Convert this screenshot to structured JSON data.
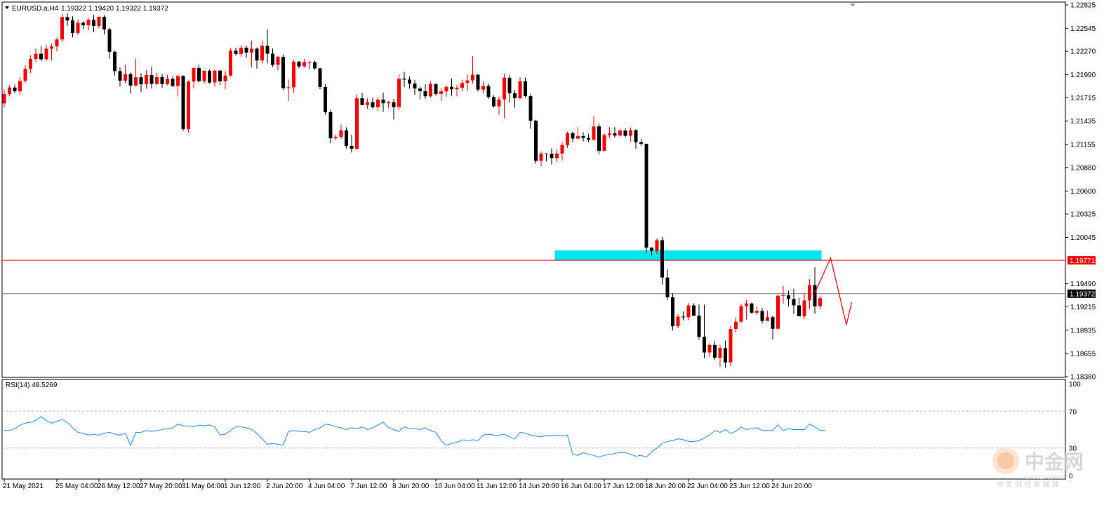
{
  "header": {
    "symbol": "EURUSD.a,H4",
    "ohlc": "1.19322 1.19420 1.19322 1.19372"
  },
  "rsi": {
    "label": "RSI(14) 49.5269",
    "levels": [
      {
        "label": "100",
        "value": 100,
        "line": false
      },
      {
        "label": "70",
        "value": 70,
        "line": true
      },
      {
        "label": "30",
        "value": 30,
        "line": true
      },
      {
        "label": "0",
        "value": 0,
        "line": false
      }
    ],
    "color": "#1e90ff",
    "values": [
      49,
      49,
      51,
      55,
      57,
      58,
      60,
      64,
      60,
      57,
      59,
      61,
      58,
      52,
      47,
      46,
      44,
      45,
      44,
      46,
      47,
      45,
      44,
      46,
      33,
      47,
      47,
      49,
      48,
      49,
      50,
      51,
      52,
      56,
      54,
      54,
      53,
      55,
      54,
      55,
      53,
      44,
      45,
      49,
      53,
      53,
      52,
      50,
      46,
      40,
      34,
      35,
      34,
      33,
      48,
      49,
      48,
      48,
      47,
      50,
      52,
      56,
      55,
      53,
      52,
      50,
      52,
      51,
      53,
      50,
      52,
      55,
      58,
      52,
      50,
      48,
      53,
      51,
      51,
      50,
      52,
      49,
      47,
      38,
      33,
      35,
      36,
      39,
      38,
      39,
      38,
      44,
      45,
      44,
      44,
      45,
      42,
      40,
      47,
      46,
      44,
      43,
      42,
      44,
      43,
      44,
      43,
      44,
      23,
      22,
      25,
      23,
      22,
      20,
      22,
      23,
      24,
      25,
      25,
      23,
      21,
      22,
      20,
      26,
      30,
      35,
      37,
      38,
      40,
      39,
      37,
      37,
      38,
      41,
      44,
      49,
      47,
      50,
      46,
      48,
      53,
      50,
      51,
      52,
      49,
      49,
      49,
      55,
      49,
      51,
      50,
      50,
      50,
      56,
      53,
      49,
      49
    ],
    "ymin": 0,
    "ymax": 100
  },
  "chart_data": {
    "type": "candlestick",
    "symbol": "EURUSD.a",
    "timeframe": "H4",
    "ylim": [
      1.1838,
      1.2285
    ],
    "y_ticks": [
      "1.22825",
      "1.22545",
      "1.22270",
      "1.21990",
      "1.21715",
      "1.21435",
      "1.21155",
      "1.20880",
      "1.20600",
      "1.20325",
      "1.20045",
      "1.19490",
      "1.19215",
      "1.18935",
      "1.18655",
      "1.18380"
    ],
    "x_ticks": [
      {
        "label": "21 May 2021",
        "index": 0
      },
      {
        "label": "25 May 04:00",
        "index": 10
      },
      {
        "label": "26 May 12:00",
        "index": 18
      },
      {
        "label": "27 May 20:00",
        "index": 26
      },
      {
        "label": "31 May 04:00",
        "index": 34
      },
      {
        "label": "1 Jun 12:00",
        "index": 42
      },
      {
        "label": "2 Jun 20:00",
        "index": 50
      },
      {
        "label": "4 Jun 04:00",
        "index": 58
      },
      {
        "label": "7 Jun 12:00",
        "index": 66
      },
      {
        "label": "8 Jun 20:00",
        "index": 74
      },
      {
        "label": "10 Jun 04:00",
        "index": 82
      },
      {
        "label": "11 Jun 12:00",
        "index": 90
      },
      {
        "label": "14 Jun 20:00",
        "index": 98
      },
      {
        "label": "16 Jun 04:00",
        "index": 106
      },
      {
        "label": "17 Jun 12:00",
        "index": 114
      },
      {
        "label": "18 Jun 20:00",
        "index": 122
      },
      {
        "label": "22 Jun 04:00",
        "index": 130
      },
      {
        "label": "23 Jun 12:00",
        "index": 138
      },
      {
        "label": "24 Jun 20:00",
        "index": 146
      }
    ],
    "bull_color": "#ff0000",
    "bear_color": "#000000",
    "resistance_line": {
      "value": 1.19771,
      "label": "1.19771",
      "color": "#ff0000"
    },
    "current_price_line": {
      "value": 1.19372,
      "label": "1.19372",
      "color": "#708090"
    },
    "zone": {
      "from": 1.19771,
      "to": 1.1989,
      "start_index": 105,
      "end_index": 155,
      "color": "#00e5ee"
    },
    "projection_arrow": {
      "points": [
        [
          154,
          1.1938
        ],
        [
          157,
          1.198
        ],
        [
          160,
          1.19
        ],
        [
          161,
          1.1927
        ]
      ],
      "color": "#ff0000"
    },
    "candles": [
      [
        1.21648,
        1.21815,
        1.21597,
        1.2176
      ],
      [
        1.2176,
        1.21864,
        1.21733,
        1.21837
      ],
      [
        1.21837,
        1.21873,
        1.21771,
        1.21792
      ],
      [
        1.21792,
        1.21962,
        1.21747,
        1.21916
      ],
      [
        1.21916,
        1.22106,
        1.21893,
        1.2206
      ],
      [
        1.2206,
        1.22222,
        1.22011,
        1.22179
      ],
      [
        1.22179,
        1.22304,
        1.22145,
        1.22241
      ],
      [
        1.22241,
        1.22335,
        1.22152,
        1.22175
      ],
      [
        1.22175,
        1.22349,
        1.22156,
        1.22301
      ],
      [
        1.22301,
        1.22359,
        1.2216,
        1.22329
      ],
      [
        1.22329,
        1.22433,
        1.22269,
        1.22411
      ],
      [
        1.22411,
        1.22716,
        1.22381,
        1.22679
      ],
      [
        1.22679,
        1.22724,
        1.22574,
        1.22639
      ],
      [
        1.22639,
        1.2269,
        1.22438,
        1.22489
      ],
      [
        1.22489,
        1.22651,
        1.22464,
        1.22611
      ],
      [
        1.22611,
        1.2263,
        1.22536,
        1.22581
      ],
      [
        1.22581,
        1.22672,
        1.22522,
        1.22646
      ],
      [
        1.22646,
        1.22708,
        1.225,
        1.22574
      ],
      [
        1.22574,
        1.22693,
        1.22546,
        1.22682
      ],
      [
        1.22682,
        1.22701,
        1.22474,
        1.22532
      ],
      [
        1.22532,
        1.22553,
        1.22183,
        1.22264
      ],
      [
        1.22264,
        1.22277,
        1.2198,
        1.22033
      ],
      [
        1.22033,
        1.22077,
        1.21849,
        1.21919
      ],
      [
        1.21919,
        1.22106,
        1.21887,
        1.21998
      ],
      [
        1.21998,
        1.22017,
        1.21767,
        1.2186
      ],
      [
        1.2186,
        1.22181,
        1.21854,
        1.2196
      ],
      [
        1.2196,
        1.22008,
        1.21783,
        1.21876
      ],
      [
        1.21876,
        1.22048,
        1.21823,
        1.21986
      ],
      [
        1.21986,
        1.22088,
        1.21825,
        1.2188
      ],
      [
        1.2188,
        1.22015,
        1.21865,
        1.21962
      ],
      [
        1.21962,
        1.22001,
        1.21834,
        1.2188
      ],
      [
        1.2188,
        1.2199,
        1.21864,
        1.2194
      ],
      [
        1.2194,
        1.21972,
        1.21844,
        1.21855
      ],
      [
        1.21855,
        1.21985,
        1.21732,
        1.21976
      ],
      [
        1.21976,
        1.21983,
        1.21317,
        1.21341
      ],
      [
        1.21341,
        1.21923,
        1.21298,
        1.21909
      ],
      [
        1.21909,
        1.22077,
        1.2183,
        1.2207
      ],
      [
        1.2207,
        1.2211,
        1.21899,
        1.21914
      ],
      [
        1.21914,
        1.22042,
        1.21884,
        1.22038
      ],
      [
        1.22038,
        1.22052,
        1.21882,
        1.21897
      ],
      [
        1.21897,
        1.22048,
        1.21849,
        1.22039
      ],
      [
        1.22039,
        1.22048,
        1.21864,
        1.21911
      ],
      [
        1.21911,
        1.22035,
        1.21819,
        1.2198
      ],
      [
        1.2198,
        1.22308,
        1.21967,
        1.22278
      ],
      [
        1.22278,
        1.22313,
        1.22218,
        1.22239
      ],
      [
        1.22239,
        1.22342,
        1.22206,
        1.22314
      ],
      [
        1.22314,
        1.22339,
        1.22194,
        1.22255
      ],
      [
        1.22255,
        1.22397,
        1.22079,
        1.22301
      ],
      [
        1.22301,
        1.22316,
        1.22062,
        1.2216
      ],
      [
        1.2216,
        1.22396,
        1.22125,
        1.22336
      ],
      [
        1.22336,
        1.22536,
        1.22127,
        1.22242
      ],
      [
        1.22242,
        1.22304,
        1.22084,
        1.22108
      ],
      [
        1.22108,
        1.22214,
        1.22043,
        1.22203
      ],
      [
        1.22203,
        1.22231,
        1.21806,
        1.21829
      ],
      [
        1.21829,
        1.21934,
        1.21678,
        1.2184
      ],
      [
        1.2184,
        1.22169,
        1.21779,
        1.22147
      ],
      [
        1.22147,
        1.22154,
        1.22066,
        1.2209
      ],
      [
        1.2209,
        1.22177,
        1.22074,
        1.2214
      ],
      [
        1.2214,
        1.2216,
        1.22053,
        1.2214
      ],
      [
        1.2214,
        1.22158,
        1.22048,
        1.22066
      ],
      [
        1.22066,
        1.22073,
        1.21818,
        1.21844
      ],
      [
        1.21844,
        1.21876,
        1.21511,
        1.21542
      ],
      [
        1.21542,
        1.21574,
        1.21172,
        1.2123
      ],
      [
        1.2123,
        1.21272,
        1.21212,
        1.21245
      ],
      [
        1.21245,
        1.21396,
        1.21224,
        1.21325
      ],
      [
        1.21325,
        1.21359,
        1.21107,
        1.21139
      ],
      [
        1.21139,
        1.21272,
        1.21061,
        1.21105
      ],
      [
        1.21105,
        1.21752,
        1.21098,
        1.21708
      ],
      [
        1.21708,
        1.21772,
        1.21631,
        1.21627
      ],
      [
        1.21627,
        1.21707,
        1.21584,
        1.21661
      ],
      [
        1.21661,
        1.21715,
        1.2158,
        1.21602
      ],
      [
        1.21602,
        1.21718,
        1.21564,
        1.21692
      ],
      [
        1.21692,
        1.21777,
        1.21546,
        1.21649
      ],
      [
        1.21649,
        1.21676,
        1.21588,
        1.21662
      ],
      [
        1.21662,
        1.217,
        1.21458,
        1.21603
      ],
      [
        1.21603,
        1.21996,
        1.21566,
        1.21943
      ],
      [
        1.21943,
        1.22024,
        1.2184,
        1.21932
      ],
      [
        1.21932,
        1.21968,
        1.21822,
        1.21884
      ],
      [
        1.21884,
        1.21925,
        1.2175,
        1.21825
      ],
      [
        1.21825,
        1.21848,
        1.21698,
        1.21794
      ],
      [
        1.21794,
        1.21874,
        1.21701,
        1.21733
      ],
      [
        1.21733,
        1.21909,
        1.21716,
        1.21876
      ],
      [
        1.21876,
        1.21887,
        1.21737,
        1.21761
      ],
      [
        1.21761,
        1.21826,
        1.21677,
        1.21791
      ],
      [
        1.21791,
        1.2186,
        1.21728,
        1.21846
      ],
      [
        1.21846,
        1.21944,
        1.21738,
        1.21817
      ],
      [
        1.21817,
        1.21868,
        1.2173,
        1.21834
      ],
      [
        1.21834,
        1.2193,
        1.21794,
        1.21891
      ],
      [
        1.21891,
        1.21993,
        1.21793,
        1.21922
      ],
      [
        1.21922,
        1.2221,
        1.21886,
        1.2199
      ],
      [
        1.2199,
        1.22,
        1.21789,
        1.21813
      ],
      [
        1.21813,
        1.21911,
        1.2177,
        1.21855
      ],
      [
        1.21855,
        1.21885,
        1.217,
        1.21723
      ],
      [
        1.21723,
        1.21745,
        1.21596,
        1.21613
      ],
      [
        1.21613,
        1.21727,
        1.21512,
        1.21695
      ],
      [
        1.21695,
        1.22002,
        1.21467,
        1.21954
      ],
      [
        1.21954,
        1.21985,
        1.2166,
        1.21768
      ],
      [
        1.21768,
        1.21807,
        1.21597,
        1.2171
      ],
      [
        1.2171,
        1.21962,
        1.21698,
        1.21911
      ],
      [
        1.21911,
        1.21955,
        1.21718,
        1.21734
      ],
      [
        1.21734,
        1.21761,
        1.21345,
        1.2144
      ],
      [
        1.2144,
        1.2145,
        1.20925,
        1.2096
      ],
      [
        1.2096,
        1.21072,
        1.20897,
        1.21047
      ],
      [
        1.21047,
        1.21049,
        1.20956,
        1.21044
      ],
      [
        1.21044,
        1.2111,
        1.20917,
        1.20993
      ],
      [
        1.20993,
        1.21097,
        1.20946,
        1.21048
      ],
      [
        1.21048,
        1.21184,
        1.20964,
        1.21149
      ],
      [
        1.21149,
        1.2131,
        1.21116,
        1.21291
      ],
      [
        1.21291,
        1.21313,
        1.21183,
        1.21227
      ],
      [
        1.21227,
        1.21367,
        1.21219,
        1.21258
      ],
      [
        1.21258,
        1.21302,
        1.21194,
        1.21234
      ],
      [
        1.21234,
        1.21283,
        1.21183,
        1.21214
      ],
      [
        1.21214,
        1.21492,
        1.21196,
        1.21372
      ],
      [
        1.21372,
        1.2141,
        1.21039,
        1.21081
      ],
      [
        1.21081,
        1.21291,
        1.21071,
        1.21269
      ],
      [
        1.21269,
        1.21367,
        1.21235,
        1.21289
      ],
      [
        1.21289,
        1.21366,
        1.21238,
        1.21263
      ],
      [
        1.21263,
        1.21347,
        1.2125,
        1.21322
      ],
      [
        1.21322,
        1.21349,
        1.21239,
        1.2126
      ],
      [
        1.2126,
        1.2136,
        1.2119,
        1.21327
      ],
      [
        1.21327,
        1.21338,
        1.21103,
        1.21183
      ],
      [
        1.21183,
        1.21225,
        1.21139,
        1.21165
      ],
      [
        1.21165,
        1.2116,
        1.1986,
        1.19923
      ],
      [
        1.19923,
        1.19928,
        1.19828,
        1.19883
      ],
      [
        1.19883,
        1.20035,
        1.19848,
        1.20011
      ],
      [
        1.20011,
        1.2005,
        1.1948,
        1.19565
      ],
      [
        1.19565,
        1.19666,
        1.19299,
        1.1933
      ],
      [
        1.1933,
        1.19377,
        1.18932,
        1.18983
      ],
      [
        1.18983,
        1.19128,
        1.18959,
        1.19098
      ],
      [
        1.19098,
        1.1916,
        1.19054,
        1.1909
      ],
      [
        1.1909,
        1.1926,
        1.19053,
        1.19231
      ],
      [
        1.19231,
        1.19255,
        1.19104,
        1.1911
      ],
      [
        1.1911,
        1.19244,
        1.18822,
        1.18856
      ],
      [
        1.18856,
        1.1924,
        1.18601,
        1.18669
      ],
      [
        1.18669,
        1.18779,
        1.18616,
        1.18759
      ],
      [
        1.18759,
        1.188,
        1.1858,
        1.18607
      ],
      [
        1.18607,
        1.18754,
        1.18497,
        1.18721
      ],
      [
        1.18721,
        1.18811,
        1.18488,
        1.1855
      ],
      [
        1.1855,
        1.18987,
        1.18508,
        1.1895
      ],
      [
        1.1895,
        1.19087,
        1.18908,
        1.19037
      ],
      [
        1.19037,
        1.1925,
        1.19021,
        1.19223
      ],
      [
        1.19223,
        1.19298,
        1.19062,
        1.19255
      ],
      [
        1.19255,
        1.19264,
        1.19128,
        1.19145
      ],
      [
        1.19145,
        1.19219,
        1.1912,
        1.19165
      ],
      [
        1.19165,
        1.192,
        1.19016,
        1.19046
      ],
      [
        1.19046,
        1.19168,
        1.19052,
        1.19091
      ],
      [
        1.19091,
        1.19109,
        1.18824,
        1.18952
      ],
      [
        1.18952,
        1.19367,
        1.18944,
        1.19347
      ],
      [
        1.19347,
        1.19466,
        1.19253,
        1.19354
      ],
      [
        1.19354,
        1.19409,
        1.19219,
        1.1931
      ],
      [
        1.1931,
        1.19428,
        1.19129,
        1.19232
      ],
      [
        1.19232,
        1.19324,
        1.19102,
        1.19103
      ],
      [
        1.19103,
        1.1937,
        1.19071,
        1.19291
      ],
      [
        1.19291,
        1.19548,
        1.19187,
        1.19475
      ],
      [
        1.19475,
        1.19689,
        1.19133,
        1.19222
      ],
      [
        1.19222,
        1.19349,
        1.19182,
        1.19318
      ]
    ]
  },
  "watermark": {
    "brand_cn": "中金网",
    "domain": "CNGOLD.COM.CN",
    "slogan_cn": "中 文 财 经 新 媒 体",
    "color": "#d0d0d0"
  }
}
